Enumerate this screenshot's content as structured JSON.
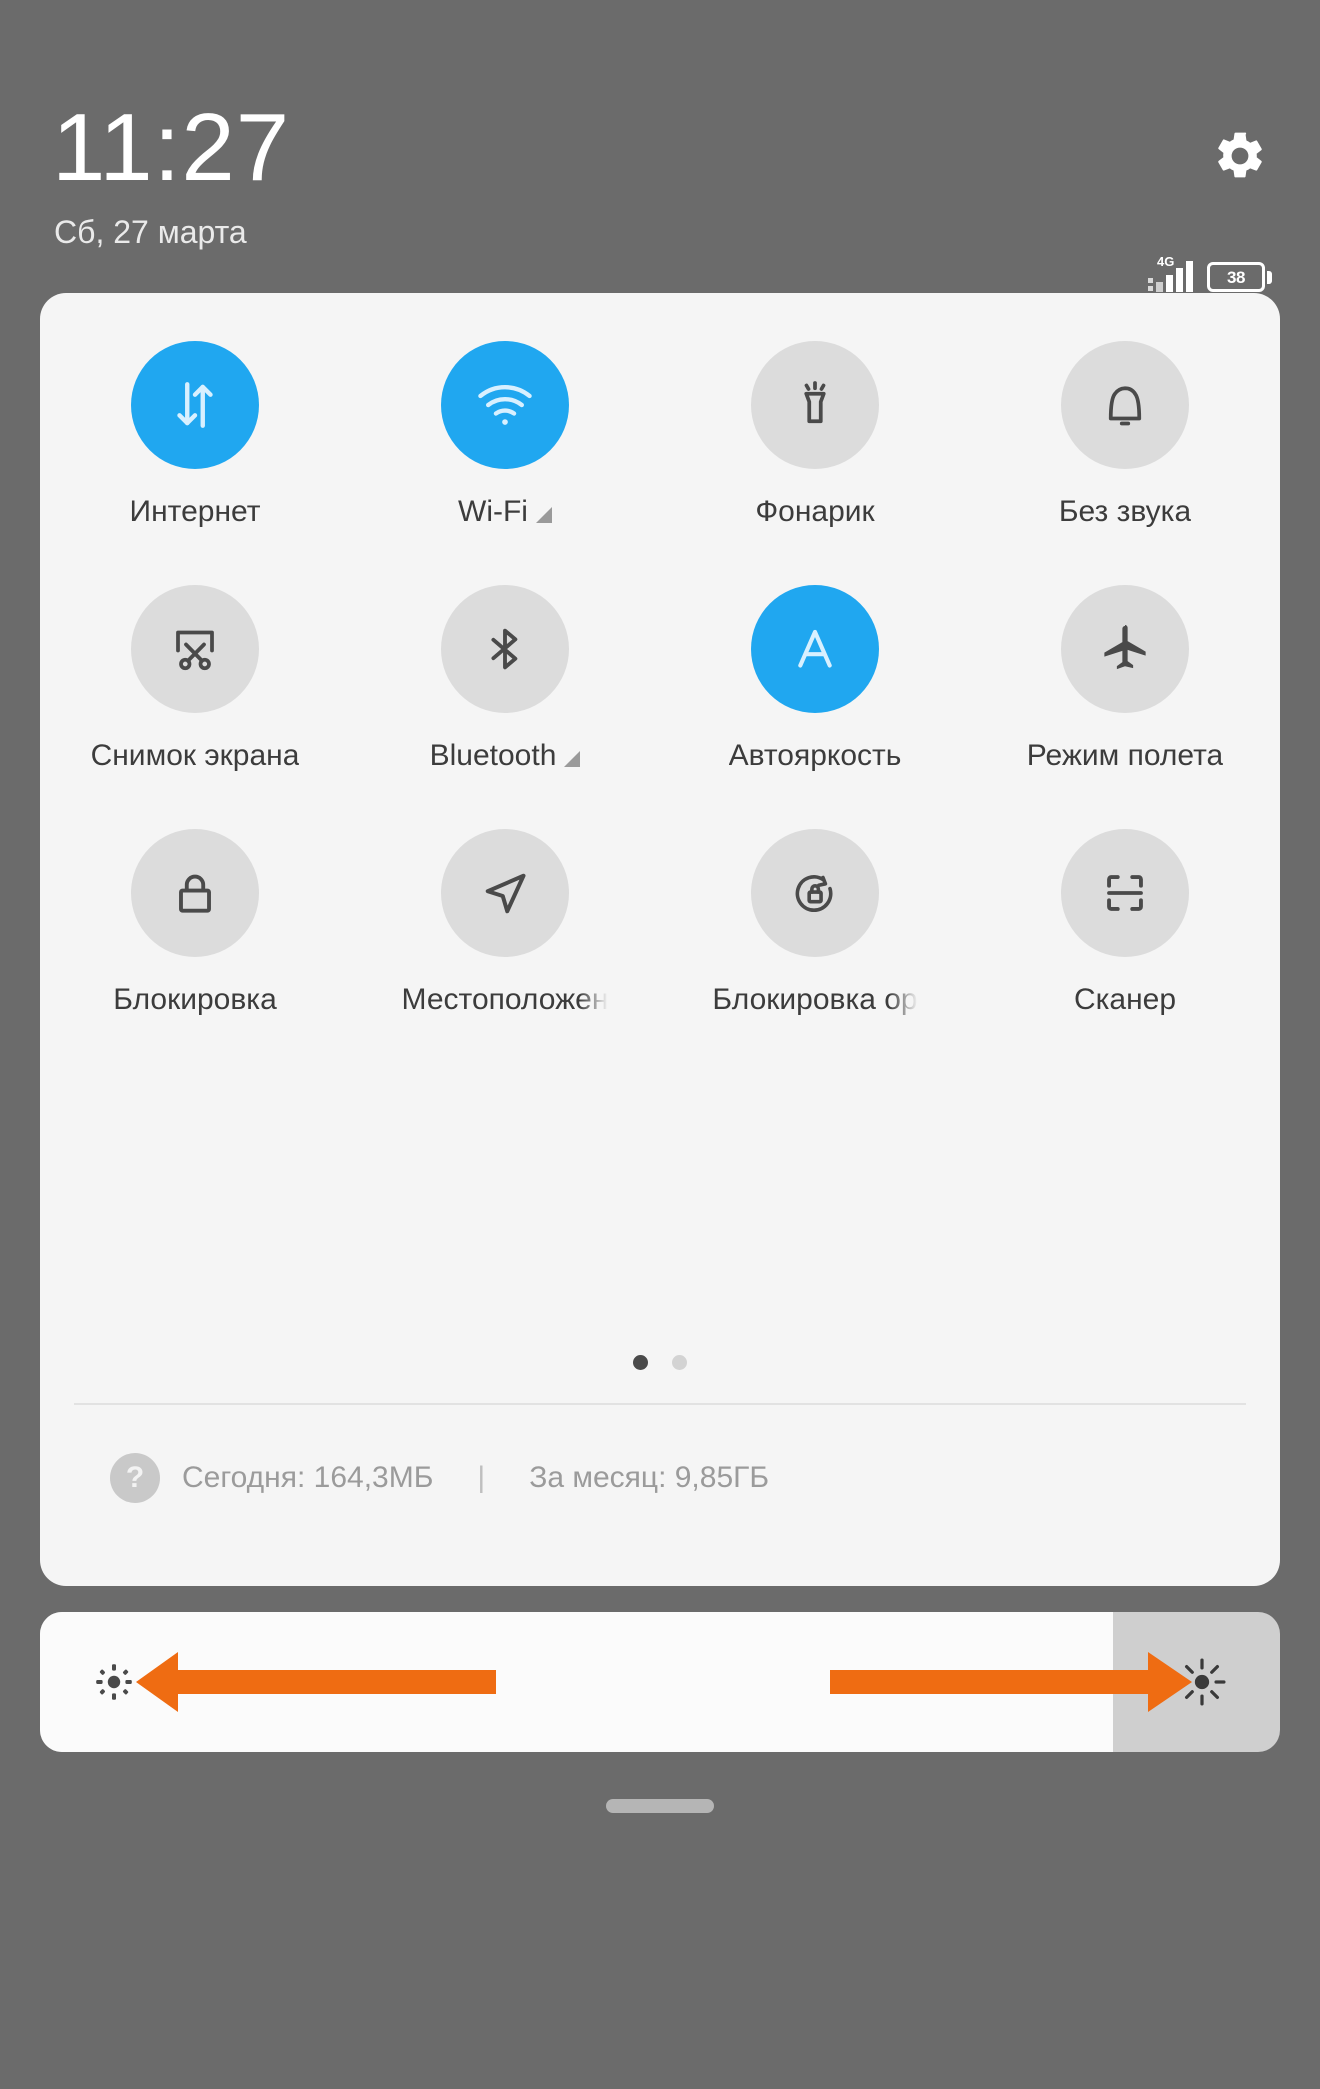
{
  "status_bar": {
    "clock": "11:27",
    "date": "Сб, 27 марта",
    "network_type": "4G",
    "battery_percent": "38",
    "settings_icon": "gear-icon",
    "signal_icon": "signal-bars-icon",
    "battery_icon": "battery-icon"
  },
  "quick_settings": {
    "tiles": [
      {
        "label": "Интернет",
        "icon": "data-transfer-icon",
        "active": true,
        "has_chevron": false,
        "truncated": false
      },
      {
        "label": "Wi-Fi",
        "icon": "wifi-icon",
        "active": true,
        "has_chevron": true,
        "truncated": false
      },
      {
        "label": "Фонарик",
        "icon": "flashlight-icon",
        "active": false,
        "has_chevron": false,
        "truncated": false
      },
      {
        "label": "Без звука",
        "icon": "bell-icon",
        "active": false,
        "has_chevron": false,
        "truncated": false
      },
      {
        "label": "Снимок экрана",
        "icon": "screenshot-icon",
        "active": false,
        "has_chevron": false,
        "truncated": false
      },
      {
        "label": "Bluetooth",
        "icon": "bluetooth-icon",
        "active": false,
        "has_chevron": true,
        "truncated": false
      },
      {
        "label": "Автояркость",
        "icon": "auto-brightness-icon",
        "active": true,
        "has_chevron": false,
        "truncated": false
      },
      {
        "label": "Режим полета",
        "icon": "airplane-icon",
        "active": false,
        "has_chevron": false,
        "truncated": false
      },
      {
        "label": "Блокировка",
        "icon": "lock-icon",
        "active": false,
        "has_chevron": false,
        "truncated": false
      },
      {
        "label": "Местоположен",
        "icon": "location-arrow-icon",
        "active": false,
        "has_chevron": false,
        "truncated": true
      },
      {
        "label": "Блокировка ор",
        "icon": "rotation-lock-icon",
        "active": false,
        "has_chevron": false,
        "truncated": true
      },
      {
        "label": "Сканер",
        "icon": "scanner-icon",
        "active": false,
        "has_chevron": false,
        "truncated": false
      }
    ],
    "pages": {
      "count": 2,
      "active_index": 0
    },
    "data_usage": {
      "help_icon": "question-mark-icon",
      "today": "Сегодня: 164,3МБ",
      "separator": "|",
      "month": "За месяц: 9,85ГБ"
    }
  },
  "brightness": {
    "low_icon": "brightness-low-icon",
    "high_icon": "brightness-high-icon",
    "fill_percent": 86,
    "annotation": {
      "left_arrow": "left-arrow-annotation",
      "right_arrow": "right-arrow-annotation",
      "color": "#ef6c12"
    }
  },
  "colors": {
    "background": "#6b6b6b",
    "panel": "#f5f5f5",
    "tile_off": "#dcdcdc",
    "tile_on": "#20a7f0",
    "label": "#3c3c3c",
    "usage_text": "#9b9b9b",
    "accent_orange": "#ef6c12"
  },
  "home_indicator": "home-indicator"
}
